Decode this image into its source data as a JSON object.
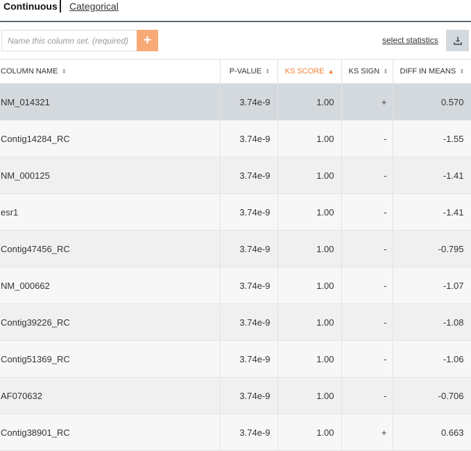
{
  "tabs": {
    "active": "Continuous",
    "other": "Categorical"
  },
  "toolbar": {
    "name_placeholder": "Name this column set. (required)",
    "add_label": "+",
    "select_statistics": "select statistics",
    "download_icon": "download-icon"
  },
  "colors": {
    "accent": "#f08030",
    "add_button": "#f7aa78",
    "selected_row": "#d4d9de"
  },
  "table": {
    "headers": [
      "COLUMN NAME",
      "P-VALUE",
      "KS SCORE",
      "KS SIGN",
      "DIFF IN MEANS"
    ],
    "sorted_column": "KS SCORE",
    "sort_direction": "ascending",
    "rows": [
      {
        "name": "NM_014321",
        "p": "3.74e-9",
        "ks": "1.00",
        "sign": "+",
        "diff": "0.570"
      },
      {
        "name": "Contig14284_RC",
        "p": "3.74e-9",
        "ks": "1.00",
        "sign": "-",
        "diff": "-1.55"
      },
      {
        "name": "NM_000125",
        "p": "3.74e-9",
        "ks": "1.00",
        "sign": "-",
        "diff": "-1.41"
      },
      {
        "name": "esr1",
        "p": "3.74e-9",
        "ks": "1.00",
        "sign": "-",
        "diff": "-1.41"
      },
      {
        "name": "Contig47456_RC",
        "p": "3.74e-9",
        "ks": "1.00",
        "sign": "-",
        "diff": "-0.795"
      },
      {
        "name": "NM_000662",
        "p": "3.74e-9",
        "ks": "1.00",
        "sign": "-",
        "diff": "-1.07"
      },
      {
        "name": "Contig39226_RC",
        "p": "3.74e-9",
        "ks": "1.00",
        "sign": "-",
        "diff": "-1.08"
      },
      {
        "name": "Contig51369_RC",
        "p": "3.74e-9",
        "ks": "1.00",
        "sign": "-",
        "diff": "-1.06"
      },
      {
        "name": "AF070632",
        "p": "3.74e-9",
        "ks": "1.00",
        "sign": "-",
        "diff": "-0.706"
      },
      {
        "name": "Contig38901_RC",
        "p": "3.74e-9",
        "ks": "1.00",
        "sign": "+",
        "diff": "0.663"
      }
    ]
  }
}
